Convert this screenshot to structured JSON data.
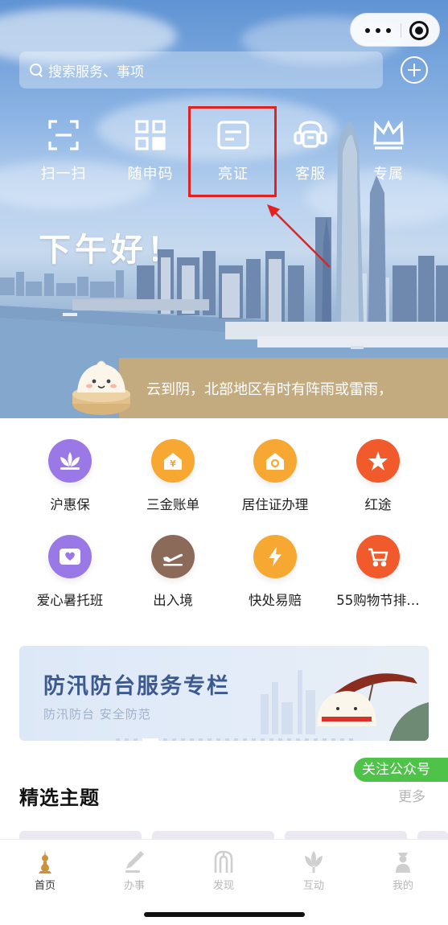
{
  "capsule": {
    "more_icon": "more-dots-icon",
    "close_icon": "target-icon"
  },
  "search": {
    "placeholder": "搜索服务、事项"
  },
  "quick_actions": [
    {
      "label": "扫一扫",
      "icon": "scan-icon"
    },
    {
      "label": "随申码",
      "icon": "qrcode-icon"
    },
    {
      "label": "亮证",
      "icon": "card-icon"
    },
    {
      "label": "客服",
      "icon": "headset-icon"
    },
    {
      "label": "专属",
      "icon": "crown-icon"
    }
  ],
  "greeting": "下午好！",
  "weather": {
    "text": "云到阴，北部地区有时有阵雨或雷雨，"
  },
  "services": [
    {
      "label": "沪惠保",
      "icon": "lotus-icon",
      "color": "#9a78e6"
    },
    {
      "label": "三金账单",
      "icon": "yuan-house-icon",
      "color": "#f7a832"
    },
    {
      "label": "居住证办理",
      "icon": "house-icon",
      "color": "#f7a832"
    },
    {
      "label": "红途",
      "icon": "star-icon",
      "color": "#f15a2b"
    },
    {
      "label": "爱心暑托班",
      "icon": "heart-card-icon",
      "color": "#9a78e6"
    },
    {
      "label": "出入境",
      "icon": "plane-icon",
      "color": "#8c6a5a"
    },
    {
      "label": "快处易赔",
      "icon": "lightning-icon",
      "color": "#f7a832"
    },
    {
      "label": "55购物节排…",
      "icon": "cart-icon",
      "color": "#f15a2b"
    }
  ],
  "banner": {
    "title": "防汛防台服务专栏",
    "subtitle": "防汛防台 安全防范"
  },
  "follow_badge": "关注公众号",
  "section": {
    "title": "精选主题",
    "more": "更多"
  },
  "tabbar": [
    {
      "label": "首页",
      "icon": "home-tower-icon",
      "active": true
    },
    {
      "label": "办事",
      "icon": "pen-icon",
      "active": false
    },
    {
      "label": "发现",
      "icon": "arch-icon",
      "active": false
    },
    {
      "label": "互动",
      "icon": "magnolia-icon",
      "active": false
    },
    {
      "label": "我的",
      "icon": "person-icon",
      "active": false
    }
  ]
}
